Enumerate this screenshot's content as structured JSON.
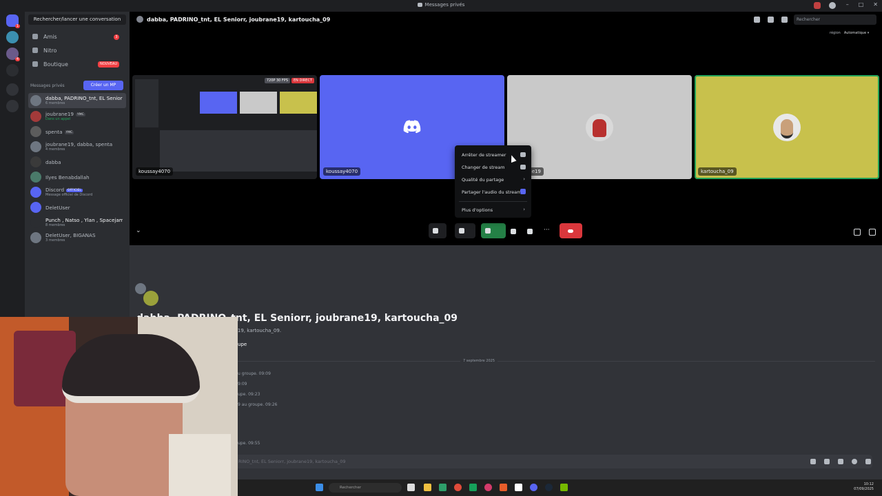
{
  "window": {
    "title": "Messages privés"
  },
  "sidebar": {
    "search_label": "Rechercher/lancer une conversation",
    "nav": [
      {
        "label": "Amis",
        "badge": "3"
      },
      {
        "label": "Nitro",
        "badge": ""
      },
      {
        "label": "Boutique",
        "badge": "NOUVEAU"
      }
    ],
    "dm_header": "Messages privés",
    "create_dm_label": "Créer un MP",
    "dms": [
      {
        "name": "dabba, PADRINO_tnt, EL Seniorr,...",
        "sub": "6 membres",
        "tag": ""
      },
      {
        "name": "joubrane19",
        "sub": "Dans un appel",
        "tag": "YMC"
      },
      {
        "name": "spenta",
        "sub": "",
        "tag": "YMC"
      },
      {
        "name": "joubrane19, dabba, spenta",
        "sub": "4 membres",
        "tag": ""
      },
      {
        "name": "dabba",
        "sub": "",
        "tag": ""
      },
      {
        "name": "Ilyes Benabdallah",
        "sub": "",
        "tag": ""
      },
      {
        "name": "Discord",
        "sub": "Message officiel de Discord",
        "tag": "OFFICIEL"
      },
      {
        "name": "DeletUser",
        "sub": "",
        "tag": ""
      },
      {
        "name": "Punch , Natso , Ylan , Spacejam",
        "sub": "8 membres",
        "tag": ""
      },
      {
        "name": "DeletUser, BIGANAS",
        "sub": "3 membres",
        "tag": ""
      }
    ]
  },
  "call": {
    "header_title": "dabba, PADRINO_tnt, EL Seniorr, joubrane19, kartoucha_09",
    "search_placeholder": "Rechercher",
    "region_label": "région",
    "region_value": "Automatique",
    "tiles": [
      {
        "label": "koussay4070",
        "quality": "720P 30 FPS",
        "live": "EN DIRECT"
      },
      {
        "label": "koussay4070"
      },
      {
        "label": "joubrane19"
      },
      {
        "label": "kartoucha_09"
      }
    ],
    "colors": {
      "accent": "#5865f2",
      "tile_gray": "#c9c9c9",
      "tile_yellow": "#c8c14c",
      "hangup": "#da373c",
      "stream_green": "#248046"
    }
  },
  "context_menu": {
    "items": [
      {
        "label": "Arrêter de streamer",
        "icon": "screen-off-icon"
      },
      {
        "label": "Changer de stream",
        "icon": "screen-icon"
      },
      {
        "label": "Qualité du partage",
        "icon": "chevron-right-icon"
      },
      {
        "label": "Partager l'audio du stream",
        "icon": "checkbox-checked-icon"
      },
      {
        "label": "Plus d'options",
        "icon": "chevron-right-icon"
      }
    ]
  },
  "chat": {
    "title": "dabba, PADRINO_tnt, EL Seniorr, joubrane19, kartoucha_09",
    "subtitle": "dabba, PADRINO_tnt, EL Seniorr, joubrane19, kartoucha_09.",
    "group_button": "roupe",
    "date_divider": "7 septembre 2025",
    "messages": [
      "u groupe. 09:09",
      "9:09",
      "upe. 09:23",
      "9 au groupe. 09:26",
      "upe. 09:55"
    ],
    "input_placeholder": "RINO_tnt, EL Seniorr, joubrane19, kartoucha_09"
  },
  "taskbar": {
    "search_placeholder": "Rechercher",
    "time": "10:12",
    "date": "07/09/2025"
  }
}
